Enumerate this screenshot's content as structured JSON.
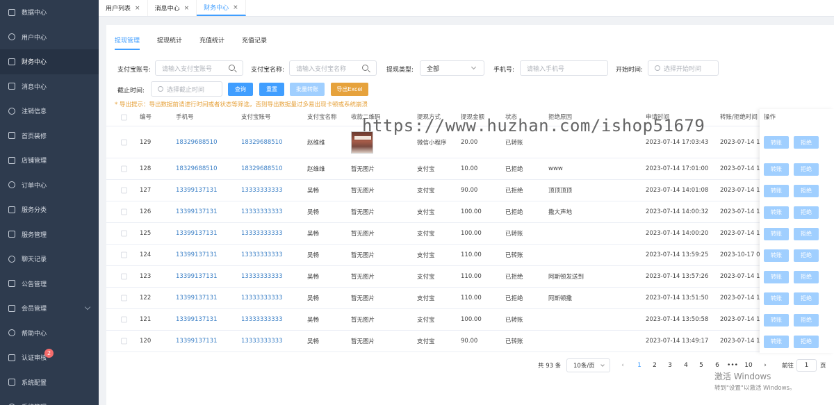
{
  "sidebar": {
    "items": [
      {
        "label": "数据中心",
        "icon": "chart-icon",
        "active": false
      },
      {
        "label": "用户中心",
        "icon": "user-icon",
        "active": false
      },
      {
        "label": "财务中心",
        "icon": "wallet-icon",
        "active": true
      },
      {
        "label": "消息中心",
        "icon": "message-icon",
        "active": false
      },
      {
        "label": "注销信息",
        "icon": "document-icon",
        "active": false
      },
      {
        "label": "首页装修",
        "icon": "box-icon",
        "active": false
      },
      {
        "label": "店铺管理",
        "icon": "shop-icon",
        "active": false
      },
      {
        "label": "订单中心",
        "icon": "order-icon",
        "active": false
      },
      {
        "label": "服务分类",
        "icon": "category-icon",
        "active": false
      },
      {
        "label": "服务管理",
        "icon": "service-icon",
        "active": false
      },
      {
        "label": "聊天记录",
        "icon": "chat-icon",
        "active": false
      },
      {
        "label": "公告管理",
        "icon": "notice-icon",
        "active": false
      },
      {
        "label": "会员管理",
        "icon": "member-icon",
        "active": false,
        "expandable": true
      },
      {
        "label": "帮助中心",
        "icon": "help-icon",
        "active": false
      },
      {
        "label": "认证审核",
        "icon": "verify-icon",
        "active": false,
        "badge": "2"
      },
      {
        "label": "系统配置",
        "icon": "list-icon",
        "active": false
      },
      {
        "label": "系统管理",
        "icon": "settings-icon",
        "active": false
      }
    ]
  },
  "tabs": [
    {
      "label": "用户列表",
      "close": "×",
      "active": false
    },
    {
      "label": "消息中心",
      "close": "×",
      "active": false
    },
    {
      "label": "财务中心",
      "close": "×",
      "active": true
    }
  ],
  "subtabs": [
    {
      "label": "提现管理",
      "active": true
    },
    {
      "label": "提现统计",
      "active": false
    },
    {
      "label": "充值统计",
      "active": false
    },
    {
      "label": "充值记录",
      "active": false
    }
  ],
  "filters": {
    "alipay_account_label": "支付宝账号:",
    "alipay_account_placeholder": "请输入支付宝账号",
    "alipay_name_label": "支付宝名称:",
    "alipay_name_placeholder": "请输入支付宝名称",
    "withdraw_type_label": "提现类型:",
    "withdraw_type_value": "全部",
    "phone_label": "手机号:",
    "phone_placeholder": "请输入手机号",
    "start_time_label": "开始时间:",
    "start_time_placeholder": "选择开始时间",
    "end_time_label": "截止时间:",
    "end_time_placeholder": "选择截止时间"
  },
  "buttons": {
    "query": "查询",
    "reset": "重置",
    "batch_transfer": "批量转账",
    "export_excel": "导出Excel"
  },
  "tip": "* 导出提示：导出数据前请进行时间或者状态等筛选，否则导出数据量过多易出现卡顿或系统崩溃",
  "watermark": "https://www.huzhan.com/ishop51679",
  "table": {
    "headers": {
      "id": "编号",
      "phone": "手机号",
      "alipay_account": "支付宝账号",
      "alipay_name": "支付宝名称",
      "qr": "收款二维码",
      "method": "提现方式",
      "amount": "提现金额",
      "status": "状态",
      "reason": "拒绝原因",
      "apply_time": "申请时间",
      "transfer_time": "转账/拒绝时间",
      "actions": "操作"
    },
    "transfer_btn": "转账",
    "reject_btn": "拒绝",
    "rows": [
      {
        "id": "129",
        "phone": "18329688510",
        "account": "18329688510",
        "name": "赵维维",
        "qr": "",
        "has_image": true,
        "method": "微信小程序",
        "amount": "20.00",
        "status": "已转账",
        "reason": "",
        "apply_time": "2023-07-14 17:03:43",
        "transfer_time": "2023-07-14 17"
      },
      {
        "id": "128",
        "phone": "18329688510",
        "account": "18329688510",
        "name": "赵维维",
        "qr": "暂无图片",
        "has_image": false,
        "method": "支付宝",
        "amount": "10.00",
        "status": "已拒绝",
        "reason": "www",
        "apply_time": "2023-07-14 17:01:00",
        "transfer_time": "2023-07-14 17"
      },
      {
        "id": "127",
        "phone": "13399137131",
        "account": "13333333333",
        "name": "吴畅",
        "qr": "暂无图片",
        "has_image": false,
        "method": "支付宝",
        "amount": "90.00",
        "status": "已拒绝",
        "reason": "顶顶顶顶",
        "apply_time": "2023-07-14 14:01:08",
        "transfer_time": "2023-07-14 14"
      },
      {
        "id": "126",
        "phone": "13399137131",
        "account": "13333333333",
        "name": "吴畅",
        "qr": "暂无图片",
        "has_image": false,
        "method": "支付宝",
        "amount": "100.00",
        "status": "已拒绝",
        "reason": "撒大声地",
        "apply_time": "2023-07-14 14:00:32",
        "transfer_time": "2023-07-14 14"
      },
      {
        "id": "125",
        "phone": "13399137131",
        "account": "13333333333",
        "name": "吴畅",
        "qr": "暂无图片",
        "has_image": false,
        "method": "支付宝",
        "amount": "100.00",
        "status": "已转账",
        "reason": "",
        "apply_time": "2023-07-14 14:00:20",
        "transfer_time": "2023-07-14 14"
      },
      {
        "id": "124",
        "phone": "13399137131",
        "account": "13333333333",
        "name": "吴畅",
        "qr": "暂无图片",
        "has_image": false,
        "method": "支付宝",
        "amount": "110.00",
        "status": "已转账",
        "reason": "",
        "apply_time": "2023-07-14 13:59:25",
        "transfer_time": "2023-10-17 09"
      },
      {
        "id": "123",
        "phone": "13399137131",
        "account": "13333333333",
        "name": "吴畅",
        "qr": "暂无图片",
        "has_image": false,
        "method": "支付宝",
        "amount": "110.00",
        "status": "已拒绝",
        "reason": "阿斯顿发送到",
        "apply_time": "2023-07-14 13:57:26",
        "transfer_time": "2023-07-14 13"
      },
      {
        "id": "122",
        "phone": "13399137131",
        "account": "13333333333",
        "name": "吴畅",
        "qr": "暂无图片",
        "has_image": false,
        "method": "支付宝",
        "amount": "110.00",
        "status": "已拒绝",
        "reason": "阿斯顿撒",
        "apply_time": "2023-07-14 13:51:50",
        "transfer_time": "2023-07-14 13"
      },
      {
        "id": "121",
        "phone": "13399137131",
        "account": "13333333333",
        "name": "吴畅",
        "qr": "暂无图片",
        "has_image": false,
        "method": "支付宝",
        "amount": "100.00",
        "status": "已转账",
        "reason": "",
        "apply_time": "2023-07-14 13:50:58",
        "transfer_time": "2023-07-14 14"
      },
      {
        "id": "120",
        "phone": "13399137131",
        "account": "13333333333",
        "name": "吴畅",
        "qr": "暂无图片",
        "has_image": false,
        "method": "支付宝",
        "amount": "90.00",
        "status": "已转账",
        "reason": "",
        "apply_time": "2023-07-14 13:49:17",
        "transfer_time": "2023-07-14 14"
      }
    ]
  },
  "pagination": {
    "total": "共 93 条",
    "page_size": "10条/页",
    "prev": "‹",
    "next": "›",
    "pages": [
      "1",
      "2",
      "3",
      "4",
      "5",
      "6",
      "•••",
      "10"
    ],
    "current": "1",
    "goto_label": "前往",
    "goto_value": "1",
    "goto_suffix": "页"
  },
  "windows_activation": {
    "line1": "激活 Windows",
    "line2": "转到\"设置\"以激活 Windows。"
  }
}
